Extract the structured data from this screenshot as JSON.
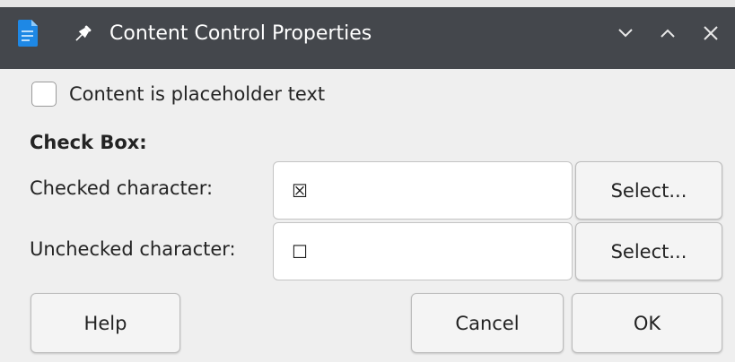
{
  "window": {
    "title": "Content Control Properties",
    "app_icon": "writer-document-icon",
    "accent_color": "#1e88e5",
    "titlebar_color": "#44474c"
  },
  "placeholder_checkbox": {
    "label": "Content is placeholder text",
    "checked": false
  },
  "check_box_section": {
    "heading": "Check Box:",
    "checked_label": "Checked character:",
    "checked_value": "☒",
    "unchecked_label": "Unchecked character:",
    "unchecked_value": "☐",
    "select_label": "Select..."
  },
  "buttons": {
    "help": "Help",
    "cancel": "Cancel",
    "ok": "OK"
  }
}
